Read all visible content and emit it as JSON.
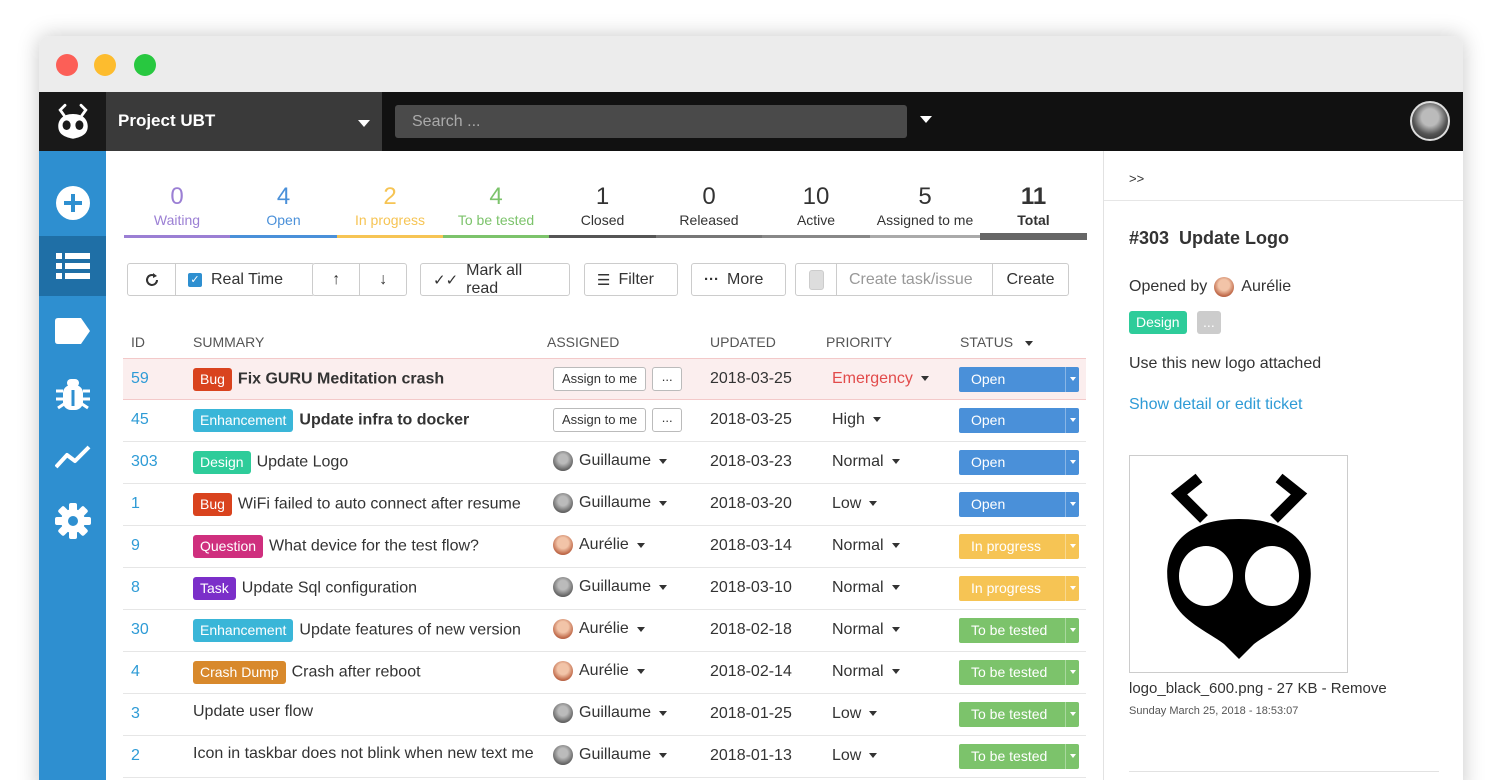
{
  "header": {
    "project": "Project UBT",
    "search_placeholder": "Search ..."
  },
  "sidebar": [
    {
      "icon": "plus-circle-icon"
    },
    {
      "icon": "list-icon",
      "active": true
    },
    {
      "icon": "tag-icon"
    },
    {
      "icon": "bug-icon"
    },
    {
      "icon": "chart-line-icon"
    },
    {
      "icon": "gear-icon"
    }
  ],
  "stats": [
    {
      "num": "0",
      "label": "Waiting",
      "color": "#9b7fd4"
    },
    {
      "num": "4",
      "label": "Open",
      "color": "#4a90d9"
    },
    {
      "num": "2",
      "label": "In progress",
      "color": "#f6c454"
    },
    {
      "num": "4",
      "label": "To be tested",
      "color": "#7cc36b"
    },
    {
      "num": "1",
      "label": "Closed",
      "color": "#555555"
    },
    {
      "num": "0",
      "label": "Released",
      "color": "#777777"
    },
    {
      "num": "10",
      "label": "Active",
      "color": "#888888"
    },
    {
      "num": "5",
      "label": "Assigned to me",
      "color": "#aaaaaa"
    },
    {
      "num": "11",
      "label": "Total",
      "color": "#666666"
    }
  ],
  "toolbar": {
    "realtime": "Real Time",
    "mark_all_read": "Mark all read",
    "filter": "Filter",
    "more": "More",
    "create_placeholder": "Create task/issue",
    "create": "Create"
  },
  "columns": {
    "id": "ID",
    "summary": "SUMMARY",
    "assigned": "ASSIGNED",
    "updated": "UPDATED",
    "priority": "PRIORITY",
    "status": "STATUS"
  },
  "assign_to_me": "Assign to me",
  "dots": "...",
  "tickets": [
    {
      "id": "59",
      "tag": "Bug",
      "tag_color": "#d9431e",
      "summary": "Fix GURU Meditation crash",
      "bold": true,
      "assignee": "",
      "avatar": "",
      "updated": "2018-03-25",
      "priority": "Emergency",
      "priority_color": "#e24b4b",
      "status": "Open",
      "status_color": "#4a90d9",
      "highlight": true
    },
    {
      "id": "45",
      "tag": "Enhancement",
      "tag_color": "#3ab6d8",
      "summary": "Update infra to docker",
      "bold": true,
      "assignee": "",
      "avatar": "",
      "updated": "2018-03-25",
      "priority": "High",
      "priority_color": "#333333",
      "status": "Open",
      "status_color": "#4a90d9"
    },
    {
      "id": "303",
      "tag": "Design",
      "tag_color": "#2ecc9a",
      "summary": "Update Logo",
      "assignee": "Guillaume",
      "avatar": "g",
      "updated": "2018-03-23",
      "priority": "Normal",
      "priority_color": "#333333",
      "status": "Open",
      "status_color": "#4a90d9"
    },
    {
      "id": "1",
      "tag": "Bug",
      "tag_color": "#d9431e",
      "summary": "WiFi failed to auto connect after resume",
      "assignee": "Guillaume",
      "avatar": "g",
      "updated": "2018-03-20",
      "priority": "Low",
      "priority_color": "#333333",
      "status": "Open",
      "status_color": "#4a90d9"
    },
    {
      "id": "9",
      "tag": "Question",
      "tag_color": "#cf2f7e",
      "summary": "What device for the test flow?",
      "assignee": "Aurélie",
      "avatar": "a",
      "updated": "2018-03-14",
      "priority": "Normal",
      "priority_color": "#333333",
      "status": "In progress",
      "status_color": "#f6c454"
    },
    {
      "id": "8",
      "tag": "Task",
      "tag_color": "#7b2fc9",
      "summary": "Update Sql configuration",
      "assignee": "Guillaume",
      "avatar": "g",
      "updated": "2018-03-10",
      "priority": "Normal",
      "priority_color": "#333333",
      "status": "In progress",
      "status_color": "#f6c454"
    },
    {
      "id": "30",
      "tag": "Enhancement",
      "tag_color": "#3ab6d8",
      "summary": "Update features of new version",
      "assignee": "Aurélie",
      "avatar": "a",
      "updated": "2018-02-18",
      "priority": "Normal",
      "priority_color": "#333333",
      "status": "To be tested",
      "status_color": "#7cc36b"
    },
    {
      "id": "4",
      "tag": "Crash Dump",
      "tag_color": "#d8892c",
      "summary": "Crash after reboot",
      "assignee": "Aurélie",
      "avatar": "a",
      "updated": "2018-02-14",
      "priority": "Normal",
      "priority_color": "#333333",
      "status": "To be tested",
      "status_color": "#7cc36b"
    },
    {
      "id": "3",
      "tag": "",
      "tag_color": "",
      "summary": "Update user flow",
      "assignee": "Guillaume",
      "avatar": "g",
      "updated": "2018-01-25",
      "priority": "Low",
      "priority_color": "#333333",
      "status": "To be tested",
      "status_color": "#7cc36b"
    },
    {
      "id": "2",
      "tag": "",
      "tag_color": "",
      "summary": "Icon in taskbar does not blink when new text me",
      "assignee": "Guillaume",
      "avatar": "g",
      "updated": "2018-01-13",
      "priority": "Low",
      "priority_color": "#333333",
      "status": "To be tested",
      "status_color": "#7cc36b"
    }
  ],
  "detail": {
    "collapse": ">>",
    "title": "#303  Update Logo",
    "opened_by_label": "Opened by",
    "opened_by": "Aurélie",
    "tag": "Design",
    "tag_color": "#2ecc9a",
    "more_tag": "...",
    "description": "Use this new logo attached",
    "link": "Show detail or edit ticket",
    "attachment": "logo_black_600.png - 27 KB - Remove",
    "attachment_date": "Sunday March 25, 2018 - 18:53:07"
  },
  "colors": {
    "accent": "#2e8fd0",
    "link": "#2e9bd6"
  }
}
